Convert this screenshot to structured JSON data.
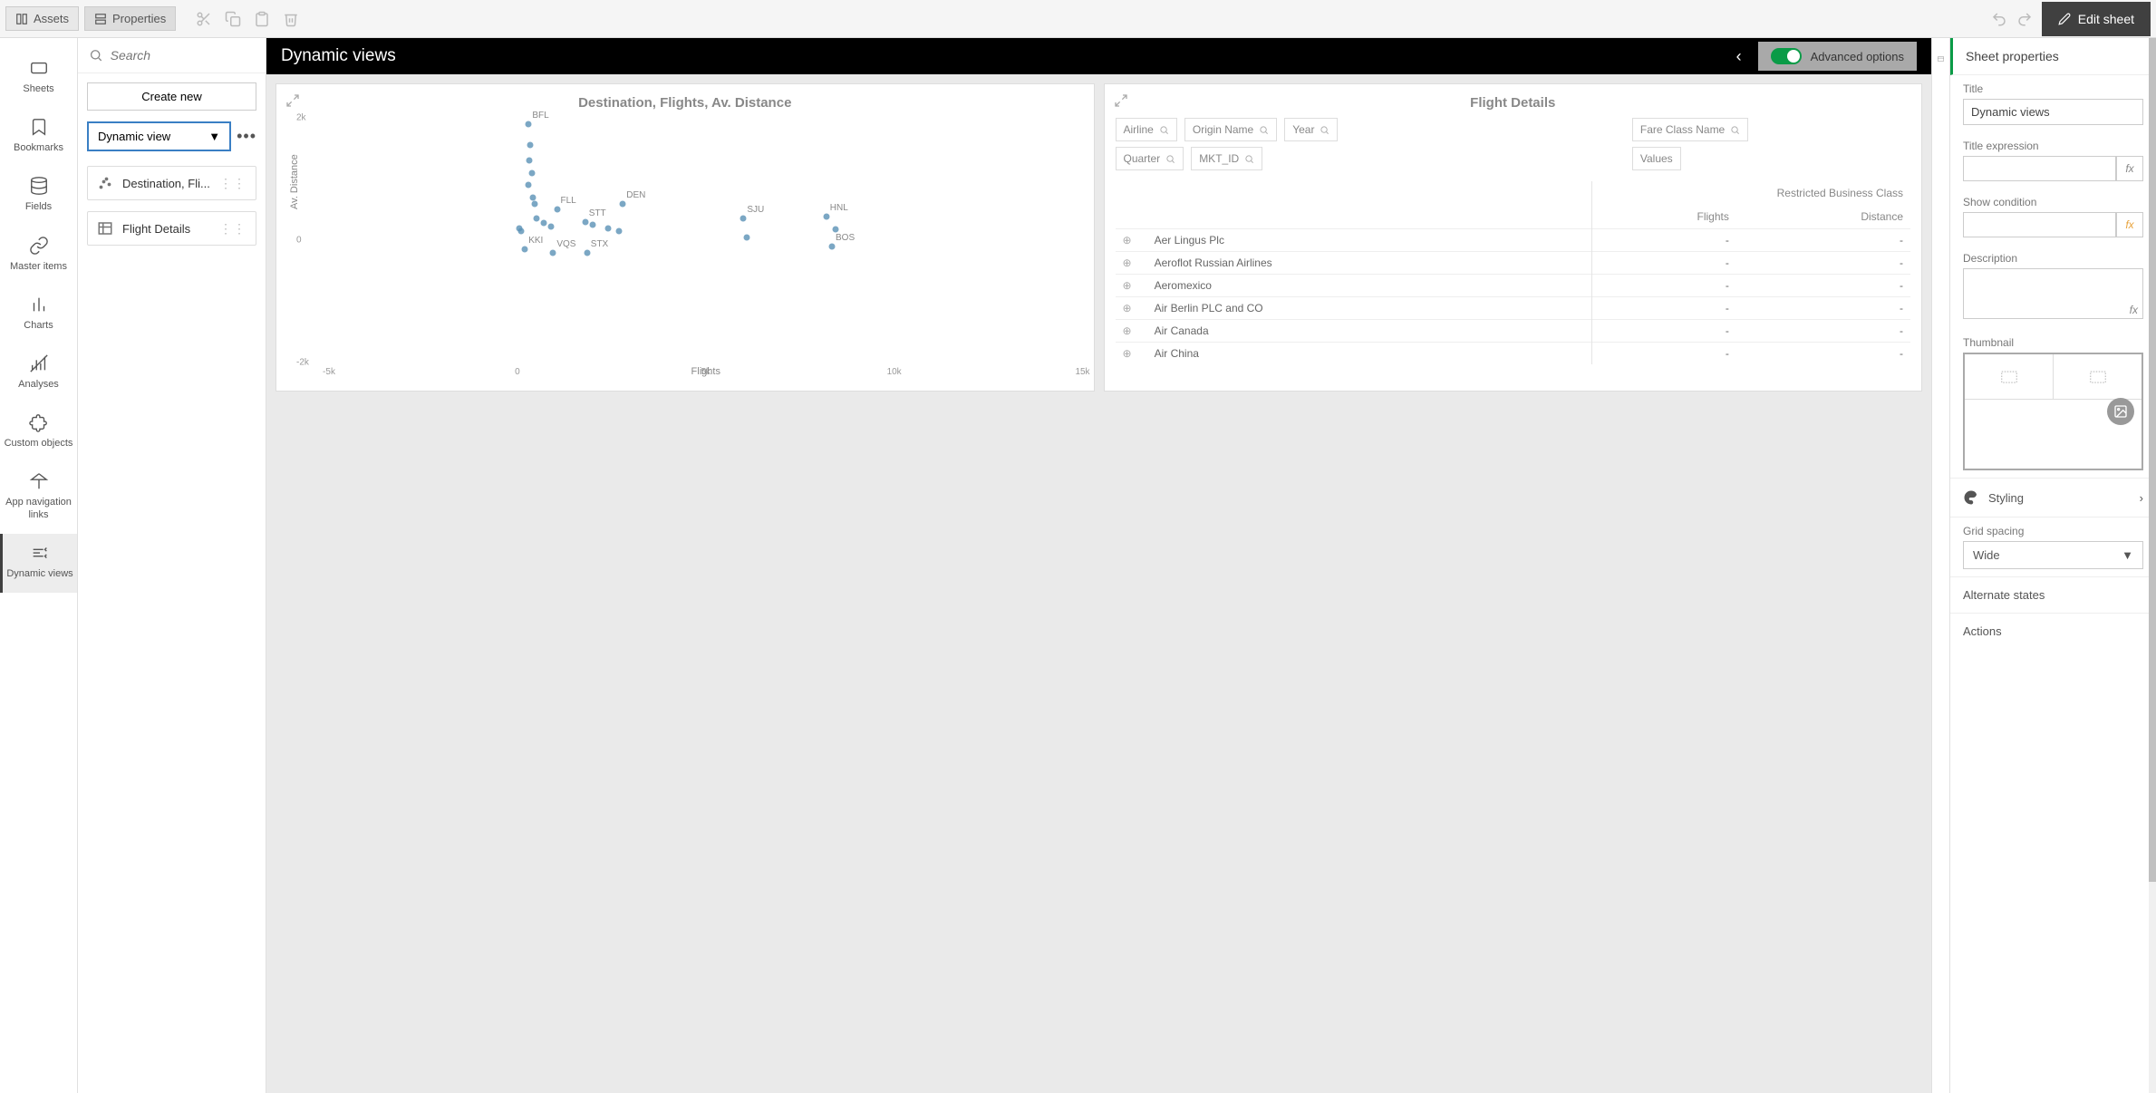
{
  "toolbar": {
    "assets_label": "Assets",
    "properties_label": "Properties",
    "edit_sheet_label": "Edit sheet"
  },
  "left_rail": {
    "items": [
      {
        "label": "Sheets"
      },
      {
        "label": "Bookmarks"
      },
      {
        "label": "Fields"
      },
      {
        "label": "Master items"
      },
      {
        "label": "Charts"
      },
      {
        "label": "Analyses"
      },
      {
        "label": "Custom objects"
      },
      {
        "label": "App navigation links"
      },
      {
        "label": "Dynamic views"
      }
    ]
  },
  "assets": {
    "search_placeholder": "Search",
    "create_new_label": "Create new",
    "dynamic_view_label": "Dynamic view",
    "cards": [
      {
        "label": "Destination, Fli..."
      },
      {
        "label": "Flight Details"
      }
    ]
  },
  "sheet": {
    "title": "Dynamic views",
    "advanced_label": "Advanced options"
  },
  "chart_data": {
    "type": "scatter",
    "title": "Destination, Flights, Av. Distance",
    "xlabel": "Flights",
    "ylabel": "Av. Distance",
    "xlim": [
      -5000,
      15000
    ],
    "ylim": [
      -2000,
      2000
    ],
    "x_ticks": [
      "-5k",
      "0",
      "5k",
      "10k",
      "15k"
    ],
    "y_ticks": [
      "-2k",
      "0",
      "2k"
    ],
    "points": [
      {
        "label": "BFL",
        "x": 300,
        "y": 1900
      },
      {
        "label": "",
        "x": 350,
        "y": 1550
      },
      {
        "label": "",
        "x": 320,
        "y": 1300
      },
      {
        "label": "",
        "x": 380,
        "y": 1100
      },
      {
        "label": "",
        "x": 300,
        "y": 900
      },
      {
        "label": "",
        "x": 400,
        "y": 700
      },
      {
        "label": "FLL",
        "x": 1050,
        "y": 500
      },
      {
        "label": "",
        "x": 450,
        "y": 600
      },
      {
        "label": "STT",
        "x": 1800,
        "y": 300
      },
      {
        "label": "DEN",
        "x": 2800,
        "y": 600
      },
      {
        "label": "",
        "x": 2000,
        "y": 250
      },
      {
        "label": "",
        "x": 2400,
        "y": 200
      },
      {
        "label": "",
        "x": 2700,
        "y": 150
      },
      {
        "label": "SJU",
        "x": 6000,
        "y": 350
      },
      {
        "label": "",
        "x": 6100,
        "y": 50
      },
      {
        "label": "HNL",
        "x": 8200,
        "y": 380
      },
      {
        "label": "",
        "x": 8450,
        "y": 180
      },
      {
        "label": "BOS",
        "x": 8350,
        "y": -100
      },
      {
        "label": "KKI",
        "x": 200,
        "y": -150
      },
      {
        "label": "",
        "x": 100,
        "y": 150
      },
      {
        "label": "",
        "x": 50,
        "y": 200
      },
      {
        "label": "",
        "x": 500,
        "y": 350
      },
      {
        "label": "",
        "x": 700,
        "y": 280
      },
      {
        "label": "",
        "x": 900,
        "y": 220
      },
      {
        "label": "VQS",
        "x": 950,
        "y": -200
      },
      {
        "label": "STX",
        "x": 1850,
        "y": -200
      }
    ]
  },
  "table": {
    "title": "Flight Details",
    "filters1": [
      "Airline",
      "Origin Name",
      "Year"
    ],
    "filters2": [
      "Quarter",
      "MKT_ID"
    ],
    "filter_fare": "Fare Class Name",
    "filter_values": "Values",
    "restricted_header": "Restricted Business Class",
    "col_flights": "Flights",
    "col_distance": "Distance",
    "rows": [
      {
        "name": "Aer Lingus Plc",
        "flights": "-",
        "distance": "-"
      },
      {
        "name": "Aeroflot Russian Airlines",
        "flights": "-",
        "distance": "-"
      },
      {
        "name": "Aeromexico",
        "flights": "-",
        "distance": "-"
      },
      {
        "name": "Air Berlin PLC and CO",
        "flights": "-",
        "distance": "-"
      },
      {
        "name": "Air Canada",
        "flights": "-",
        "distance": "-"
      },
      {
        "name": "Air China",
        "flights": "-",
        "distance": "-"
      }
    ]
  },
  "props": {
    "section": "Sheet properties",
    "title_label": "Title",
    "title_value": "Dynamic views",
    "title_expr_label": "Title expression",
    "show_cond_label": "Show condition",
    "description_label": "Description",
    "thumbnail_label": "Thumbnail",
    "styling_label": "Styling",
    "grid_spacing_label": "Grid spacing",
    "grid_spacing_value": "Wide",
    "alt_states_label": "Alternate states",
    "actions_label": "Actions"
  }
}
